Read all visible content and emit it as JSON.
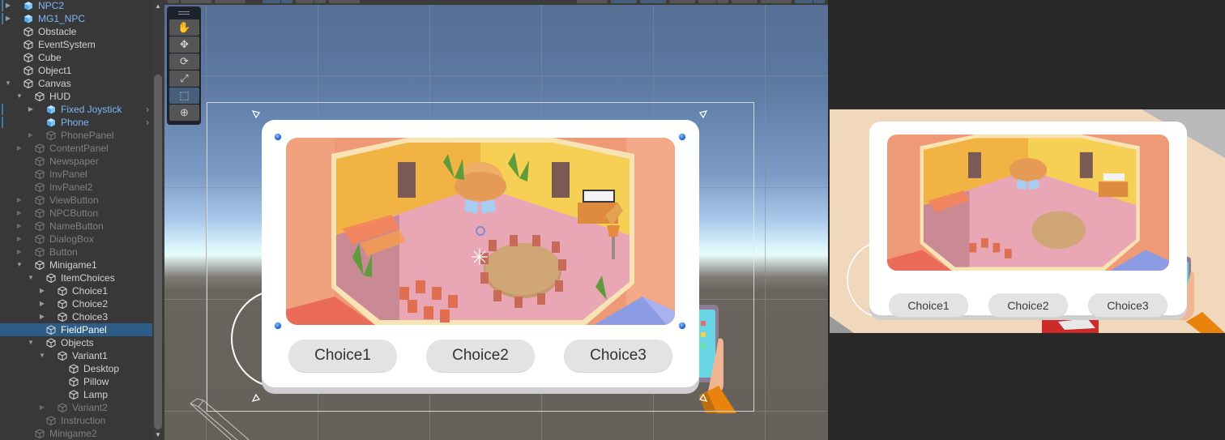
{
  "hierarchy": {
    "items": [
      {
        "label": "NPC2",
        "depth": 1,
        "arrow": "collapsed",
        "kind": "prefab",
        "override": true
      },
      {
        "label": "MG1_NPC",
        "depth": 1,
        "arrow": "collapsed",
        "kind": "prefab",
        "override": true
      },
      {
        "label": "Obstacle",
        "depth": 1,
        "arrow": "none",
        "kind": "normal"
      },
      {
        "label": "EventSystem",
        "depth": 1,
        "arrow": "none",
        "kind": "normal"
      },
      {
        "label": "Cube",
        "depth": 1,
        "arrow": "none",
        "kind": "normal"
      },
      {
        "label": "Object1",
        "depth": 1,
        "arrow": "none",
        "kind": "normal"
      },
      {
        "label": "Canvas",
        "depth": 1,
        "arrow": "expanded",
        "kind": "normal"
      },
      {
        "label": "HUD",
        "depth": 2,
        "arrow": "expanded",
        "kind": "normal"
      },
      {
        "label": "Fixed Joystick",
        "depth": 3,
        "arrow": "collapsed",
        "kind": "prefab",
        "override": true,
        "more": true
      },
      {
        "label": "Phone",
        "depth": 3,
        "arrow": "none",
        "kind": "prefab",
        "override": true,
        "more": true
      },
      {
        "label": "PhonePanel",
        "depth": 3,
        "arrow": "collapsed",
        "kind": "dim"
      },
      {
        "label": "ContentPanel",
        "depth": 2,
        "arrow": "collapsed",
        "kind": "dim"
      },
      {
        "label": "Newspaper",
        "depth": 2,
        "arrow": "none",
        "kind": "dim"
      },
      {
        "label": "InvPanel",
        "depth": 2,
        "arrow": "none",
        "kind": "dim"
      },
      {
        "label": "InvPanel2",
        "depth": 2,
        "arrow": "none",
        "kind": "dim"
      },
      {
        "label": "ViewButton",
        "depth": 2,
        "arrow": "collapsed",
        "kind": "dim"
      },
      {
        "label": "NPCButton",
        "depth": 2,
        "arrow": "collapsed",
        "kind": "dim"
      },
      {
        "label": "NameButton",
        "depth": 2,
        "arrow": "collapsed",
        "kind": "dim"
      },
      {
        "label": "DialogBox",
        "depth": 2,
        "arrow": "collapsed",
        "kind": "dim"
      },
      {
        "label": "Button",
        "depth": 2,
        "arrow": "collapsed",
        "kind": "dim"
      },
      {
        "label": "Minigame1",
        "depth": 2,
        "arrow": "expanded",
        "kind": "normal"
      },
      {
        "label": "ItemChoices",
        "depth": 3,
        "arrow": "expanded",
        "kind": "normal"
      },
      {
        "label": "Choice1",
        "depth": 4,
        "arrow": "collapsed",
        "kind": "normal"
      },
      {
        "label": "Choice2",
        "depth": 4,
        "arrow": "collapsed",
        "kind": "normal"
      },
      {
        "label": "Choice3",
        "depth": 4,
        "arrow": "collapsed",
        "kind": "normal"
      },
      {
        "label": "FieldPanel",
        "depth": 3,
        "arrow": "none",
        "kind": "selected"
      },
      {
        "label": "Objects",
        "depth": 3,
        "arrow": "expanded",
        "kind": "normal"
      },
      {
        "label": "Variant1",
        "depth": 4,
        "arrow": "expanded",
        "kind": "normal"
      },
      {
        "label": "Desktop",
        "depth": 5,
        "arrow": "none",
        "kind": "normal"
      },
      {
        "label": "Pillow",
        "depth": 5,
        "arrow": "none",
        "kind": "normal"
      },
      {
        "label": "Lamp",
        "depth": 5,
        "arrow": "none",
        "kind": "normal"
      },
      {
        "label": "Variant2",
        "depth": 4,
        "arrow": "collapsed",
        "kind": "dim"
      },
      {
        "label": "Instruction",
        "depth": 3,
        "arrow": "none",
        "kind": "dim"
      },
      {
        "label": "Minigame2",
        "depth": 2,
        "arrow": "none",
        "kind": "dim"
      }
    ]
  },
  "scene": {
    "tools": [
      {
        "name": "hand-tool",
        "icon": "hand-icon",
        "glyph": "✋",
        "active": false
      },
      {
        "name": "move-tool",
        "icon": "move-icon",
        "glyph": "✥",
        "active": false
      },
      {
        "name": "rotate-tool",
        "icon": "rotate-icon",
        "glyph": "⟳",
        "active": false
      },
      {
        "name": "scale-tool",
        "icon": "scale-icon",
        "glyph": "⤢",
        "active": false
      },
      {
        "name": "rect-tool",
        "icon": "rect-transform-icon",
        "glyph": "⬚",
        "active": true
      },
      {
        "name": "transform-tool",
        "icon": "transform-icon",
        "glyph": "⊕",
        "active": false
      }
    ],
    "panel": {
      "choices": [
        "Choice1",
        "Choice2",
        "Choice3"
      ]
    }
  },
  "game": {
    "panel": {
      "choices": [
        "Choice1",
        "Choice2",
        "Choice3"
      ]
    }
  },
  "colors": {
    "selection": "#2c5d87",
    "prefab_text": "#7cb6f5",
    "active_tool": "#46607c",
    "handle_blue": "#1f64d6"
  }
}
